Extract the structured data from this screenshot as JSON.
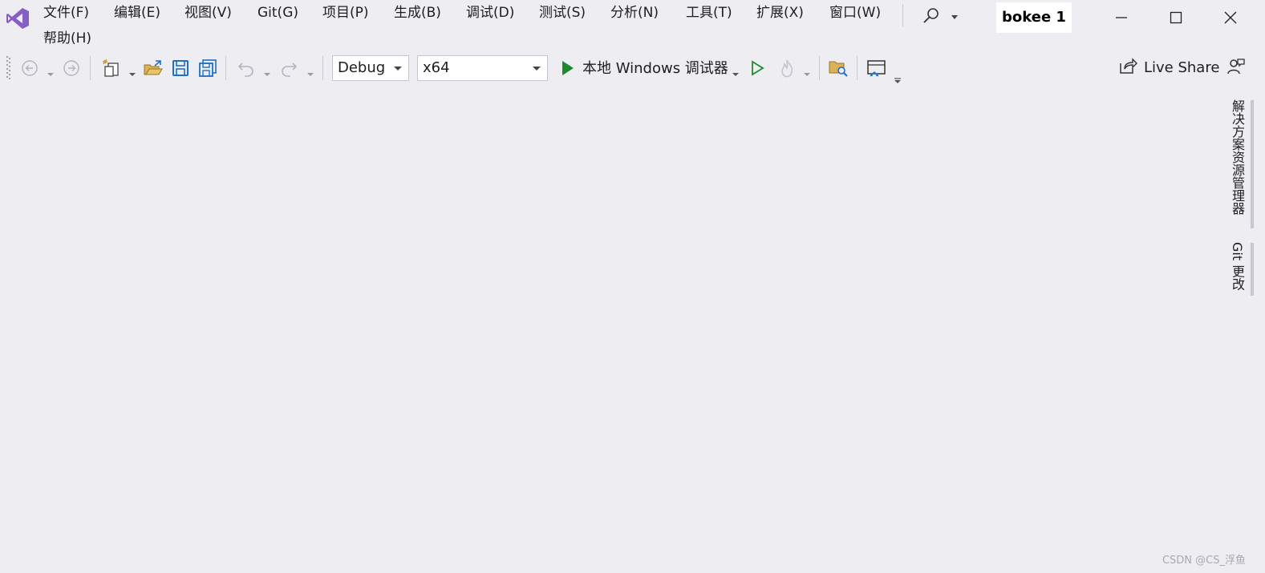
{
  "menu": {
    "items": [
      "文件(F)",
      "编辑(E)",
      "视图(V)",
      "Git(G)",
      "项目(P)",
      "生成(B)",
      "调试(D)",
      "测试(S)",
      "分析(N)",
      "工具(T)",
      "扩展(X)",
      "窗口(W)"
    ],
    "help": "帮助(H)"
  },
  "title_badge": "bokee 1",
  "toolbar": {
    "configuration": "Debug",
    "platform": "x64",
    "run_label": "本地 Windows 调试器",
    "live_share": "Live Share"
  },
  "side_tabs": [
    "解决方案资源管理器",
    "Git 更改"
  ],
  "watermark": "CSDN @CS_浮鱼",
  "colors": {
    "background": "#eeeef2",
    "vs_purple": "#865fc5",
    "run_green": "#1e8a2e",
    "save_blue": "#1e6fc9",
    "folder_yellow": "#c89a2b"
  },
  "icons": [
    "visual-studio-logo-icon",
    "search-icon",
    "minimize-icon",
    "maximize-icon",
    "close-icon",
    "back-icon",
    "forward-icon",
    "new-project-icon",
    "open-folder-icon",
    "save-icon",
    "save-all-icon",
    "undo-icon",
    "redo-icon",
    "run-icon",
    "run-without-debug-icon",
    "hot-reload-icon",
    "find-in-files-icon",
    "browser-icon",
    "live-share-icon",
    "feedback-icon"
  ]
}
